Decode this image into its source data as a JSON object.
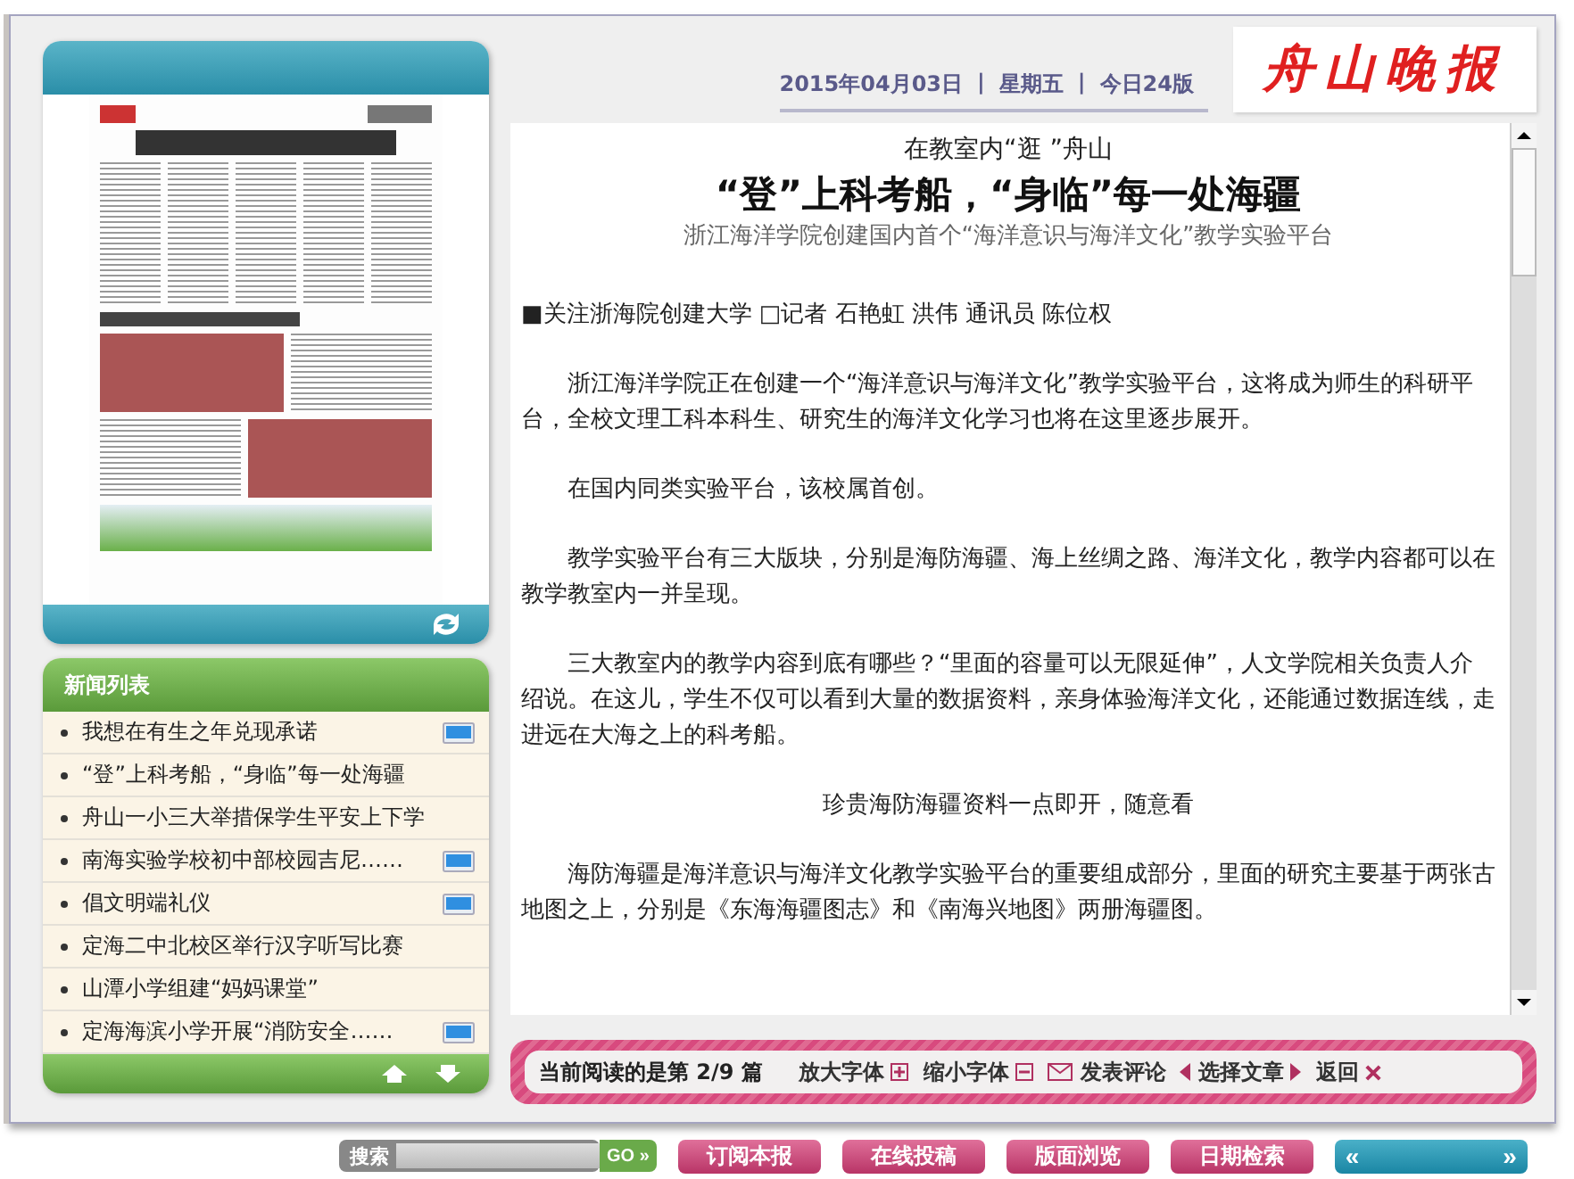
{
  "header": {
    "date": "2015年04月03日",
    "weekday": "星期五",
    "pages": "今日24版",
    "separator": "|",
    "logo": "舟山晚报"
  },
  "news_list": {
    "title": "新闻列表",
    "items": [
      {
        "title": "我想在有生之年兑现承诺",
        "has_video": true
      },
      {
        "title": "“登”上科考船，“身临”每一处海疆",
        "has_video": false
      },
      {
        "title": "舟山一小三大举措保学生平安上下学",
        "has_video": false
      },
      {
        "title": "南海实验学校初中部校园吉尼……",
        "has_video": true
      },
      {
        "title": "倡文明端礼仪",
        "has_video": true
      },
      {
        "title": "定海二中北校区举行汉字听写比赛",
        "has_video": false
      },
      {
        "title": "山潭小学组建“妈妈课堂”",
        "has_video": false
      },
      {
        "title": "定海海滨小学开展“消防安全……",
        "has_video": true
      }
    ]
  },
  "article": {
    "kicker": "在教室内“逛 ”舟山",
    "title": "“登”上科考船，“身临”每一处海疆",
    "subtitle": "浙江海洋学院创建国内首个“海洋意识与海洋文化”教学实验平台",
    "paragraphs": [
      {
        "kind": "byline",
        "text": "■关注浙海院创建大学 □记者 石艳虹 洪伟 通讯员 陈位权"
      },
      {
        "kind": "body",
        "text": "浙江海洋学院正在创建一个“海洋意识与海洋文化”教学实验平台，这将成为师生的科研平台，全校文理工科本科生、研究生的海洋文化学习也将在这里逐步展开。"
      },
      {
        "kind": "body",
        "text": "在国内同类实验平台，该校属首创。"
      },
      {
        "kind": "body",
        "text": "教学实验平台有三大版块，分别是海防海疆、海上丝绸之路、海洋文化，教学内容都可以在教学教室内一并呈现。"
      },
      {
        "kind": "body",
        "text": "三大教室内的教学内容到底有哪些？“里面的容量可以无限延伸”，人文学院相关负责人介绍说。在这儿，学生不仅可以看到大量的数据资料，亲身体验海洋文化，还能通过数据连线，走进远在大海之上的科考船。"
      },
      {
        "kind": "subhead",
        "text": "珍贵海防海疆资料一点即开，随意看"
      },
      {
        "kind": "body",
        "text": "海防海疆是海洋意识与海洋文化教学实验平台的重要组成部分，里面的研究主要基于两张古地图之上，分别是《东海海疆图志》和《南海兴地图》两册海疆图。"
      }
    ]
  },
  "toolbar": {
    "reading": "当前阅读的是第 2/9 篇",
    "actions": [
      {
        "kind": "zoom_in",
        "label": "放大字体"
      },
      {
        "kind": "zoom_out",
        "label": "缩小字体"
      },
      {
        "kind": "comment",
        "label": "发表评论"
      },
      {
        "kind": "select",
        "label": "选择文章"
      },
      {
        "kind": "back",
        "label": "返回"
      }
    ]
  },
  "bottom_nav": {
    "search_label": "搜索",
    "go": "GO »",
    "buttons": [
      "订阅本报",
      "在线投稿",
      "版面浏览",
      "日期检索"
    ],
    "pager": {
      "prev": "«",
      "next": "»"
    }
  }
}
